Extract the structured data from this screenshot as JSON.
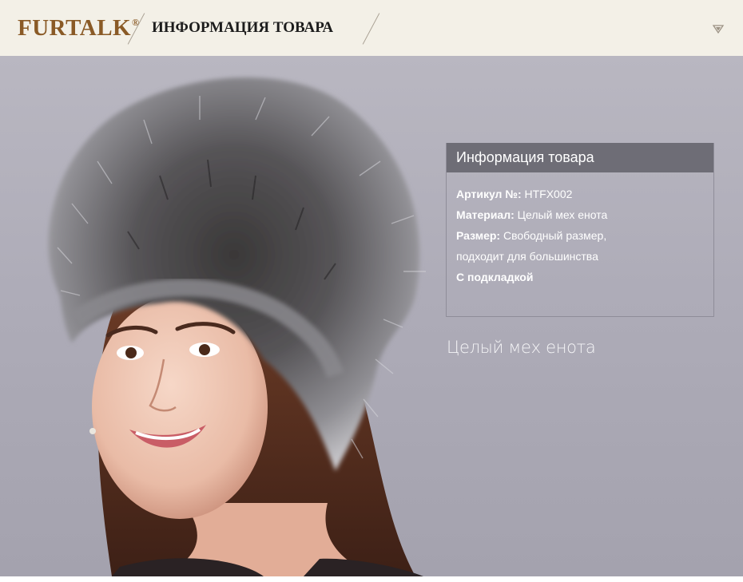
{
  "header": {
    "brand": "FURTALK",
    "brand_mark": "®",
    "title": "ИНФОРМАЦИЯ ТОВАРА",
    "expand_icon": "chevron-down-icon"
  },
  "hero": {
    "image": "woman-in-silver-fox-fur-hat",
    "background_color": "#b0aeba"
  },
  "info_panel": {
    "title": "Информация товара",
    "article_label": "Артикул №:",
    "article_value": "HTFX002",
    "material_label": "Материал:",
    "material_value": "Целый мех енота",
    "size_label": "Размер:",
    "size_value_line1": "Свободный размер,",
    "size_value_line2": "подходит для большинства",
    "lining": "С подкладкой"
  },
  "caption": "Целый мех енота",
  "colors": {
    "brand": "#8a5a26",
    "header_bg": "#f3f0e7",
    "panel_title_bg": "#6e6d76"
  }
}
